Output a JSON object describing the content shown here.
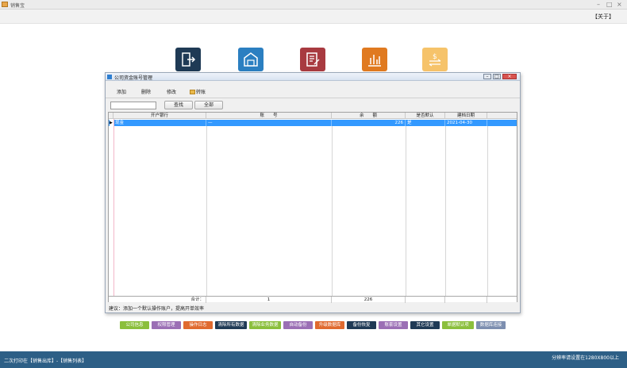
{
  "app": {
    "title": "销售宝",
    "about_label": "【关于】"
  },
  "tiles": [
    {
      "color": "#1f3a55",
      "icon": "exit-door-icon"
    },
    {
      "color": "#2b7fc1",
      "icon": "warehouse-icon"
    },
    {
      "color": "#a83a40",
      "icon": "document-edit-icon"
    },
    {
      "color": "#e07a20",
      "icon": "chart-bars-icon"
    },
    {
      "color": "#f6c36a",
      "icon": "money-transfer-icon"
    }
  ],
  "dialog": {
    "title": "公司资金账号管理",
    "controls": {
      "minimize": "–",
      "maximize": "□",
      "close": "×"
    },
    "toolbar": {
      "add": "添加",
      "delete": "删除",
      "edit": "修改",
      "transfer": "转账"
    },
    "search": {
      "value": "",
      "search_btn": "查找",
      "all_btn": "全部"
    },
    "columns": [
      "开户银行",
      "账　　号",
      "余　　额",
      "是否默认",
      "建档日期"
    ],
    "rows": [
      {
        "marker": "▶",
        "bank": "现金",
        "account": "—",
        "balance": "226",
        "default": "是",
        "date": "2021-04-30"
      }
    ],
    "totals": {
      "label": "合计：",
      "count": "1",
      "balance": "226"
    },
    "hint": "建议：添加一个默认操作账户，提高开单效率"
  },
  "action_buttons": [
    {
      "label": "公司信息",
      "color": "#8bbf3c"
    },
    {
      "label": "权限管理",
      "color": "#9b6fb5"
    },
    {
      "label": "操作日志",
      "color": "#e06a2f"
    },
    {
      "label": "清除所有数据",
      "color": "#1f3a55"
    },
    {
      "label": "清除业务数据",
      "color": "#8bbf3c"
    },
    {
      "label": "自动备份",
      "color": "#9b6fb5"
    },
    {
      "label": "升级数据库",
      "color": "#e06a2f"
    },
    {
      "label": "备份恢复",
      "color": "#1f3a55"
    },
    {
      "label": "账套设置",
      "color": "#9b6fb5"
    },
    {
      "label": "其它设置",
      "color": "#1f3a55"
    },
    {
      "label": "单据默认项",
      "color": "#8bbf3c"
    },
    {
      "label": "数据库连接",
      "color": "#7d8fb0"
    }
  ],
  "status": {
    "left": "二次打印在【销售出库】-【销售列表】",
    "right": "分辨率请设置在1280X800以上"
  }
}
